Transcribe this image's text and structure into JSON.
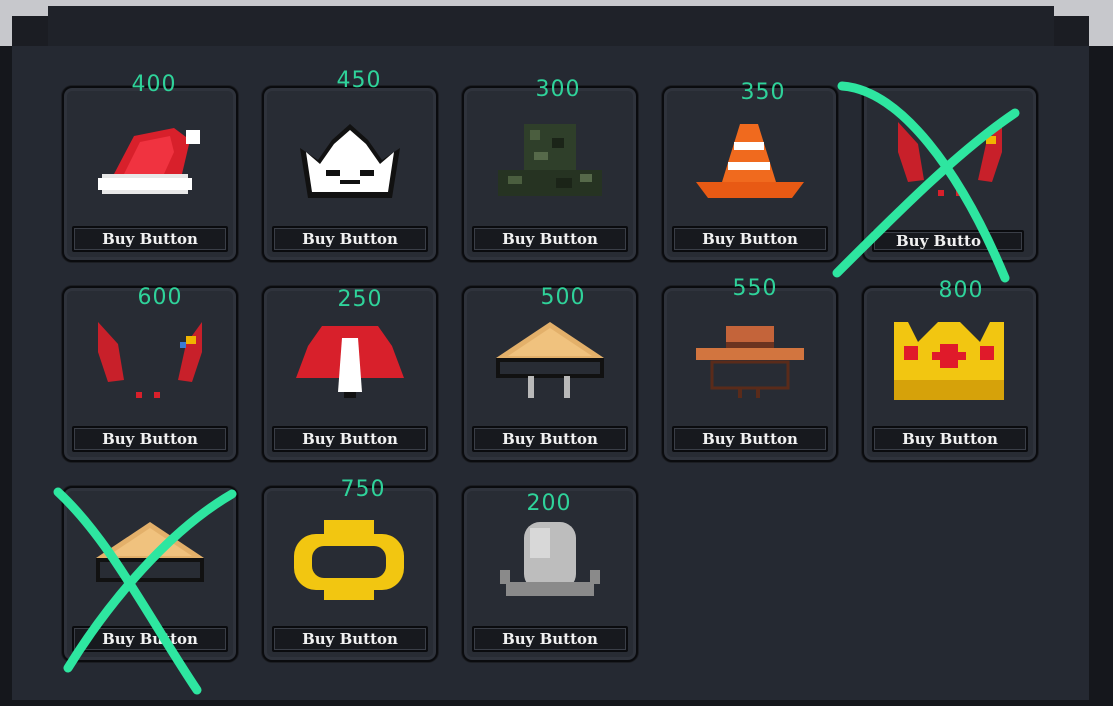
{
  "shop": {
    "items": [
      {
        "name": "Santa Hat",
        "price": "400",
        "button": "Buy Button",
        "icon": "santa-hat-icon"
      },
      {
        "name": "Paper Crown",
        "price": "450",
        "button": "Buy Button",
        "icon": "white-crown-icon"
      },
      {
        "name": "Camo Bucket Hat",
        "price": "300",
        "button": "Buy Button",
        "icon": "camo-hat-icon"
      },
      {
        "name": "Traffic Cone",
        "price": "350",
        "button": "Buy Button",
        "icon": "traffic-cone-icon"
      },
      {
        "name": "Devil Horns",
        "price": "",
        "button": "Buy Butto",
        "icon": "devil-horns-icon",
        "crossed_out": true
      },
      {
        "name": "Devil Horns",
        "price": "600",
        "button": "Buy Button",
        "icon": "devil-horns-icon"
      },
      {
        "name": "Red Hood",
        "price": "250",
        "button": "Buy Button",
        "icon": "red-hood-icon"
      },
      {
        "name": "Straw Hat",
        "price": "500",
        "button": "Buy Button",
        "icon": "straw-hat-icon"
      },
      {
        "name": "Cowboy Hat",
        "price": "550",
        "button": "Buy Button",
        "icon": "cowboy-hat-icon"
      },
      {
        "name": "Gold Crown",
        "price": "800",
        "button": "Buy Button",
        "icon": "gold-crown-icon"
      },
      {
        "name": "Straw Hat",
        "price": "",
        "button": "Buy Button",
        "icon": "straw-hat-icon",
        "crossed_out": true
      },
      {
        "name": "Halo",
        "price": "750",
        "button": "Buy Button",
        "icon": "halo-icon"
      },
      {
        "name": "Tombstone",
        "price": "200",
        "button": "Buy Button",
        "icon": "tombstone-icon"
      }
    ]
  },
  "colors": {
    "price_text": "#2fd39a",
    "cross_mark": "#2ee6a0",
    "panel": "#252932",
    "card": "#282c34"
  }
}
